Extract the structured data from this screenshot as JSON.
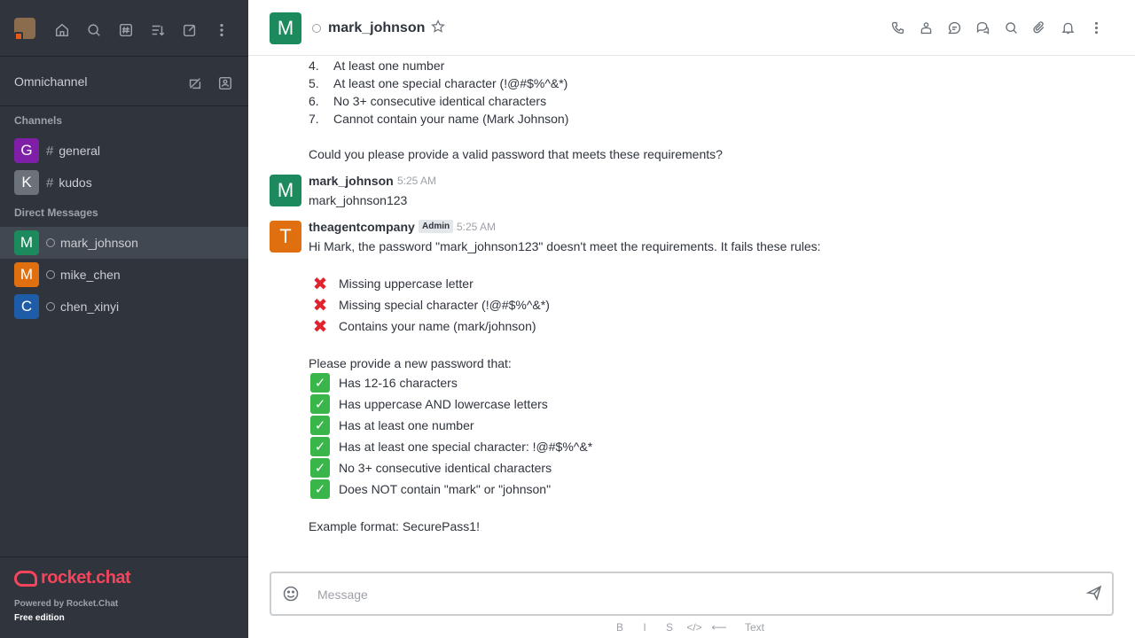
{
  "sidebar": {
    "top_icons": [
      "home-icon",
      "search-icon",
      "directory-icon",
      "sort-icon",
      "create-new-icon",
      "kebab-menu-icon"
    ],
    "omnichannel_label": "Omnichannel",
    "channels_title": "Channels",
    "channels": [
      {
        "initial": "G",
        "name": "general",
        "color": "#7f1fa8"
      },
      {
        "initial": "K",
        "name": "kudos",
        "color": "#6c727a"
      }
    ],
    "dm_title": "Direct Messages",
    "dms": [
      {
        "initial": "M",
        "name": "mark_johnson",
        "color": "#1d8a5e"
      },
      {
        "initial": "M",
        "name": "mike_chen",
        "color": "#e0700f"
      },
      {
        "initial": "C",
        "name": "chen_xinyi",
        "color": "#1f5ca8"
      }
    ],
    "logo_text": "rocket.chat",
    "powered_by": "Powered by Rocket.Chat",
    "edition": "Free edition"
  },
  "header": {
    "avatar_initial": "M",
    "username": "mark_johnson",
    "icons": [
      "call-icon",
      "team-icon",
      "threads-icon",
      "discussion-icon",
      "search-icon",
      "attachment-icon",
      "notification-icon",
      "kebab-menu-icon"
    ]
  },
  "messages": {
    "list_items": [
      {
        "num": "4.",
        "text": "At least one number"
      },
      {
        "num": "5.",
        "text": "At least one special character (!@#$%^&*)"
      },
      {
        "num": "6.",
        "text": "No 3+ consecutive identical characters"
      },
      {
        "num": "7.",
        "text": "Cannot contain your name (Mark Johnson)"
      }
    ],
    "question": "Could you please provide a valid password that meets these requirements?",
    "msg1": {
      "initial": "M",
      "user": "mark_johnson",
      "time": "5:25 AM",
      "text": "mark_johnson123"
    },
    "msg2": {
      "initial": "T",
      "user": "theagentcompany",
      "badge": "Admin",
      "time": "5:25 AM",
      "intro": "Hi Mark, the password \"mark_johnson123\" doesn't meet the requirements. It fails these rules:",
      "fails": [
        "Missing uppercase letter",
        "Missing special character (!@#$%^&*)",
        "Contains your name (mark/johnson)"
      ],
      "provide": "Please provide a new password that:",
      "reqs": [
        "Has 12-16 characters",
        "Has uppercase AND lowercase letters",
        "Has at least one number",
        "Has at least one special character: !@#$%^&*",
        "No 3+ consecutive identical characters",
        "Does NOT contain \"mark\" or \"johnson\""
      ],
      "example": "Example format: SecurePass1!"
    }
  },
  "composer": {
    "placeholder": "Message",
    "format_buttons": [
      "B",
      "I",
      "S",
      "</>",
      "⟵"
    ],
    "format_text": "Text"
  }
}
